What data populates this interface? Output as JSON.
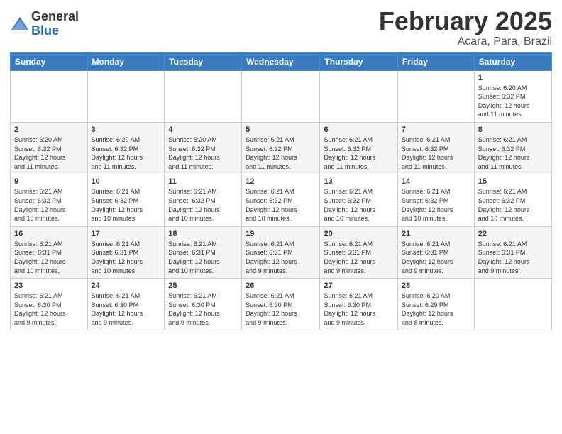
{
  "header": {
    "logo_general": "General",
    "logo_blue": "Blue",
    "month_title": "February 2025",
    "location": "Acara, Para, Brazil"
  },
  "weekdays": [
    "Sunday",
    "Monday",
    "Tuesday",
    "Wednesday",
    "Thursday",
    "Friday",
    "Saturday"
  ],
  "weeks": [
    [
      {
        "day": "",
        "info": ""
      },
      {
        "day": "",
        "info": ""
      },
      {
        "day": "",
        "info": ""
      },
      {
        "day": "",
        "info": ""
      },
      {
        "day": "",
        "info": ""
      },
      {
        "day": "",
        "info": ""
      },
      {
        "day": "1",
        "info": "Sunrise: 6:20 AM\nSunset: 6:32 PM\nDaylight: 12 hours\nand 11 minutes."
      }
    ],
    [
      {
        "day": "2",
        "info": "Sunrise: 6:20 AM\nSunset: 6:32 PM\nDaylight: 12 hours\nand 11 minutes."
      },
      {
        "day": "3",
        "info": "Sunrise: 6:20 AM\nSunset: 6:32 PM\nDaylight: 12 hours\nand 11 minutes."
      },
      {
        "day": "4",
        "info": "Sunrise: 6:20 AM\nSunset: 6:32 PM\nDaylight: 12 hours\nand 11 minutes."
      },
      {
        "day": "5",
        "info": "Sunrise: 6:21 AM\nSunset: 6:32 PM\nDaylight: 12 hours\nand 11 minutes."
      },
      {
        "day": "6",
        "info": "Sunrise: 6:21 AM\nSunset: 6:32 PM\nDaylight: 12 hours\nand 11 minutes."
      },
      {
        "day": "7",
        "info": "Sunrise: 6:21 AM\nSunset: 6:32 PM\nDaylight: 12 hours\nand 11 minutes."
      },
      {
        "day": "8",
        "info": "Sunrise: 6:21 AM\nSunset: 6:32 PM\nDaylight: 12 hours\nand 11 minutes."
      }
    ],
    [
      {
        "day": "9",
        "info": "Sunrise: 6:21 AM\nSunset: 6:32 PM\nDaylight: 12 hours\nand 10 minutes."
      },
      {
        "day": "10",
        "info": "Sunrise: 6:21 AM\nSunset: 6:32 PM\nDaylight: 12 hours\nand 10 minutes."
      },
      {
        "day": "11",
        "info": "Sunrise: 6:21 AM\nSunset: 6:32 PM\nDaylight: 12 hours\nand 10 minutes."
      },
      {
        "day": "12",
        "info": "Sunrise: 6:21 AM\nSunset: 6:32 PM\nDaylight: 12 hours\nand 10 minutes."
      },
      {
        "day": "13",
        "info": "Sunrise: 6:21 AM\nSunset: 6:32 PM\nDaylight: 12 hours\nand 10 minutes."
      },
      {
        "day": "14",
        "info": "Sunrise: 6:21 AM\nSunset: 6:32 PM\nDaylight: 12 hours\nand 10 minutes."
      },
      {
        "day": "15",
        "info": "Sunrise: 6:21 AM\nSunset: 6:32 PM\nDaylight: 12 hours\nand 10 minutes."
      }
    ],
    [
      {
        "day": "16",
        "info": "Sunrise: 6:21 AM\nSunset: 6:31 PM\nDaylight: 12 hours\nand 10 minutes."
      },
      {
        "day": "17",
        "info": "Sunrise: 6:21 AM\nSunset: 6:31 PM\nDaylight: 12 hours\nand 10 minutes."
      },
      {
        "day": "18",
        "info": "Sunrise: 6:21 AM\nSunset: 6:31 PM\nDaylight: 12 hours\nand 10 minutes."
      },
      {
        "day": "19",
        "info": "Sunrise: 6:21 AM\nSunset: 6:31 PM\nDaylight: 12 hours\nand 9 minutes."
      },
      {
        "day": "20",
        "info": "Sunrise: 6:21 AM\nSunset: 6:31 PM\nDaylight: 12 hours\nand 9 minutes."
      },
      {
        "day": "21",
        "info": "Sunrise: 6:21 AM\nSunset: 6:31 PM\nDaylight: 12 hours\nand 9 minutes."
      },
      {
        "day": "22",
        "info": "Sunrise: 6:21 AM\nSunset: 6:31 PM\nDaylight: 12 hours\nand 9 minutes."
      }
    ],
    [
      {
        "day": "23",
        "info": "Sunrise: 6:21 AM\nSunset: 6:30 PM\nDaylight: 12 hours\nand 9 minutes."
      },
      {
        "day": "24",
        "info": "Sunrise: 6:21 AM\nSunset: 6:30 PM\nDaylight: 12 hours\nand 9 minutes."
      },
      {
        "day": "25",
        "info": "Sunrise: 6:21 AM\nSunset: 6:30 PM\nDaylight: 12 hours\nand 9 minutes."
      },
      {
        "day": "26",
        "info": "Sunrise: 6:21 AM\nSunset: 6:30 PM\nDaylight: 12 hours\nand 9 minutes."
      },
      {
        "day": "27",
        "info": "Sunrise: 6:21 AM\nSunset: 6:30 PM\nDaylight: 12 hours\nand 9 minutes."
      },
      {
        "day": "28",
        "info": "Sunrise: 6:20 AM\nSunset: 6:29 PM\nDaylight: 12 hours\nand 8 minutes."
      },
      {
        "day": "",
        "info": ""
      }
    ]
  ]
}
